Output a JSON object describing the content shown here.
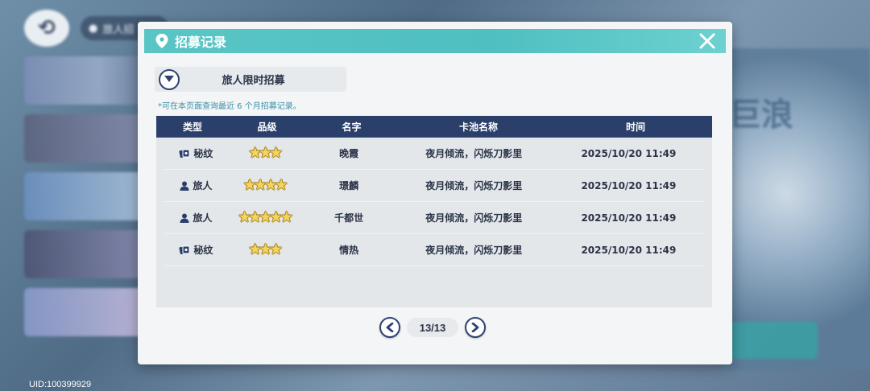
{
  "dialog": {
    "title": "招募记录",
    "pool_dropdown": "旅人限时招募",
    "hint": "*可在本页面查询最近 6 个月招募记录。"
  },
  "table": {
    "headers": [
      "类型",
      "品级",
      "名字",
      "卡池名称",
      "时间"
    ],
    "rows": [
      {
        "type": "秘纹",
        "type_icon": "rune-card-icon",
        "stars": 3,
        "name": "晚霞",
        "pool": "夜月倾流，闪烁刀影里",
        "time": "2025/10/20 11:49"
      },
      {
        "type": "旅人",
        "type_icon": "person-icon",
        "stars": 4,
        "name": "璟麟",
        "pool": "夜月倾流，闪烁刀影里",
        "time": "2025/10/20 11:49"
      },
      {
        "type": "旅人",
        "type_icon": "person-icon",
        "stars": 5,
        "name": "千都世",
        "pool": "夜月倾流，闪烁刀影里",
        "time": "2025/10/20 11:49"
      },
      {
        "type": "秘纹",
        "type_icon": "rune-card-icon",
        "stars": 3,
        "name": "情热",
        "pool": "夜月倾流，闪烁刀影里",
        "time": "2025/10/20 11:49"
      }
    ]
  },
  "pager": {
    "page": "13/13"
  },
  "footer": {
    "uid": "UID:100399929"
  },
  "background": {
    "location_chip": "旅人招"
  },
  "colors": {
    "header_teal": "#52c2c3",
    "table_head_navy": "#2b3f6b",
    "star_gold": "#f6d35a",
    "hint_teal": "#3c8fa5"
  }
}
